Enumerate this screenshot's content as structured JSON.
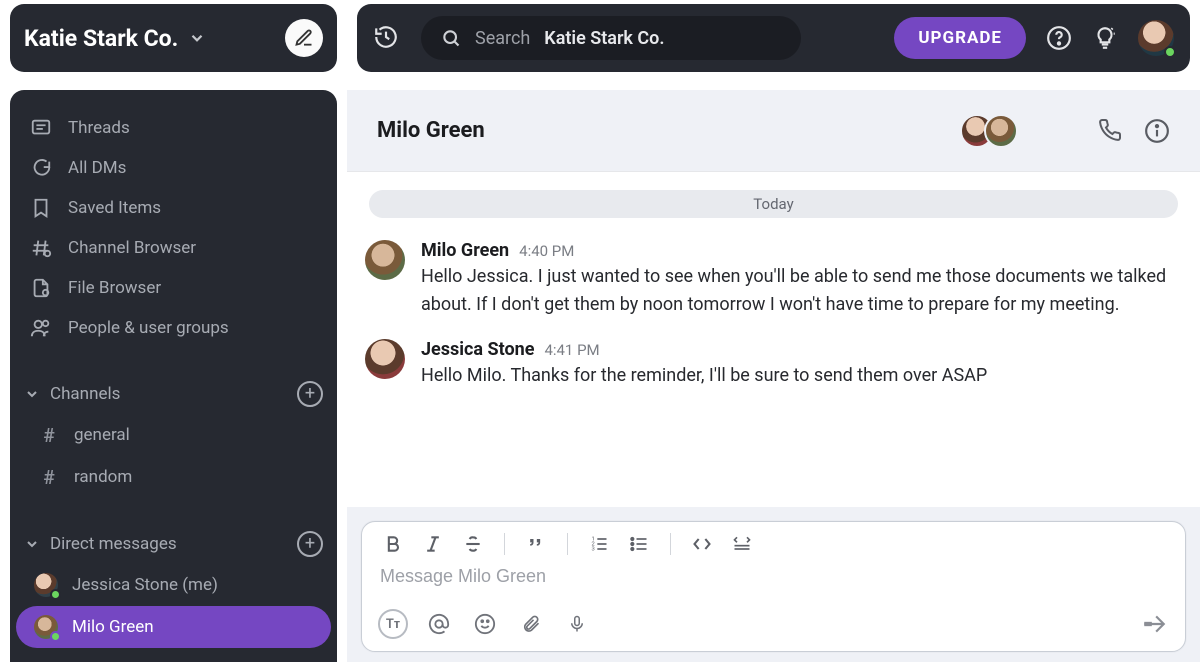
{
  "workspace": {
    "name": "Katie Stark Co."
  },
  "sidebar": {
    "nav": [
      {
        "label": "Threads"
      },
      {
        "label": "All DMs"
      },
      {
        "label": "Saved Items"
      },
      {
        "label": "Channel Browser"
      },
      {
        "label": "File Browser"
      },
      {
        "label": "People & user groups"
      }
    ],
    "channels_header": "Channels",
    "channels": [
      {
        "name": "general"
      },
      {
        "name": "random"
      }
    ],
    "dms_header": "Direct messages",
    "dms": [
      {
        "name": "Jessica Stone (me)",
        "active": false
      },
      {
        "name": "Milo Green",
        "active": true
      }
    ]
  },
  "topbar": {
    "search_static": "Search",
    "search_bold": "Katie Stark Co.",
    "upgrade": "UPGRADE"
  },
  "conversation": {
    "title": "Milo Green",
    "date_divider": "Today",
    "messages": [
      {
        "author": "Milo Green",
        "time": "4:40 PM",
        "body": "Hello Jessica. I just wanted to see when you'll be able to send me those documents we talked about. If I don't get them by noon tomorrow I won't have time to prepare for my meeting."
      },
      {
        "author": "Jessica Stone",
        "time": "4:41 PM",
        "body": "Hello Milo. Thanks for the reminder, I'll be sure to send them over ASAP"
      }
    ],
    "composer_placeholder": "Message Milo Green"
  }
}
